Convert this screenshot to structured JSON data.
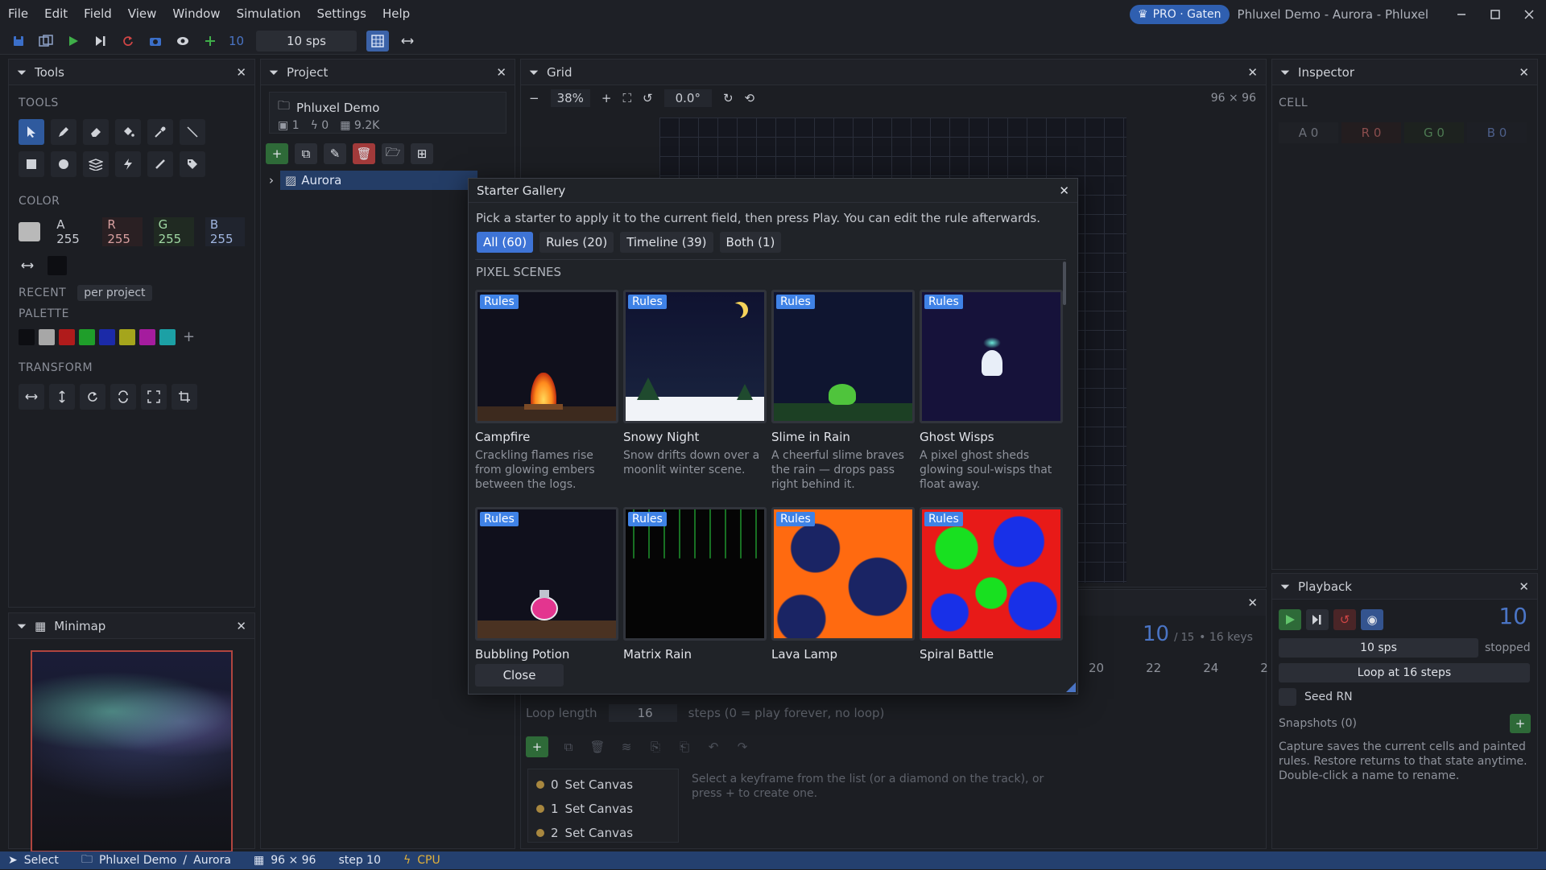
{
  "menu": [
    "File",
    "Edit",
    "Field",
    "View",
    "Window",
    "Simulation",
    "Settings",
    "Help"
  ],
  "window": {
    "badge": "PRO · Gaten",
    "title": "Phluxel Demo - Aurora - Phluxel"
  },
  "toolbar": {
    "step_count": "10",
    "sps": "10 sps"
  },
  "tools_panel": {
    "title": "Tools",
    "tools_label": "TOOLS",
    "color_label": "COLOR",
    "a": "A 255",
    "r": "R 255",
    "g": "G 255",
    "b": "B 255",
    "recent_label": "RECENT",
    "recent_mode": "per project",
    "palette_label": "PALETTE",
    "transform_label": "TRANSFORM",
    "palette": [
      "#0d0e12",
      "#a7a7a7",
      "#b01b1b",
      "#1f9e2a",
      "#1b2aa8",
      "#a5a51c",
      "#a51c9e",
      "#1ca0a5"
    ]
  },
  "minimap": {
    "title": "Minimap"
  },
  "project": {
    "title": "Project",
    "name": "Phluxel Demo",
    "images": "1",
    "rules": "0",
    "size": "9.2K",
    "item": "Aurora"
  },
  "grid_panel": {
    "title": "Grid",
    "zoom": "38%",
    "angle": "0.0°",
    "dims": "96 × 96"
  },
  "inspector": {
    "title": "Inspector",
    "cell_label": "CELL",
    "a": "A 0",
    "r": "R 0",
    "g": "G 0",
    "b": "B 0"
  },
  "playback": {
    "title": "Playback",
    "step": "10",
    "state": "stopped",
    "sps": "10 sps",
    "loop": "Loop at 16 steps",
    "seed": "Seed RN",
    "snapshots": "Snapshots (0)",
    "help": "Capture saves the current cells and painted rules. Restore returns to that state anytime. Double-click a name to rename."
  },
  "timeline": {
    "step": "10",
    "of": "/ 15",
    "keys": "• 16 keys",
    "ticks": [
      "20",
      "22",
      "24",
      "2"
    ],
    "loop_label": "Loop length",
    "loop_value": "16",
    "loop_hint": "steps (0 = play forever, no loop)",
    "hint": "Select a keyframe from the list (or a diamond on the track), or press + to create one.",
    "keyframes": [
      {
        "i": "0",
        "label": "Set Canvas"
      },
      {
        "i": "1",
        "label": "Set Canvas"
      },
      {
        "i": "2",
        "label": "Set Canvas"
      }
    ]
  },
  "gallery": {
    "title": "Starter Gallery",
    "subtitle": "Pick a starter to apply it to the current field, then press Play. You can edit the rule afterwards.",
    "tabs": [
      "All (60)",
      "Rules (20)",
      "Timeline (39)",
      "Both (1)"
    ],
    "section": "PIXEL SCENES",
    "close_label": "Close",
    "cards": [
      {
        "tag": "Rules",
        "title": "Campfire",
        "desc": "Crackling flames rise from glowing embers between the logs."
      },
      {
        "tag": "Rules",
        "title": "Snowy Night",
        "desc": "Snow drifts down over a moonlit winter scene."
      },
      {
        "tag": "Rules",
        "title": "Slime in Rain",
        "desc": "A cheerful slime braves the rain — drops pass right behind it."
      },
      {
        "tag": "Rules",
        "title": "Ghost Wisps",
        "desc": "A pixel ghost sheds glowing soul-wisps that float away."
      },
      {
        "tag": "Rules",
        "title": "Bubbling Potion",
        "desc": ""
      },
      {
        "tag": "Rules",
        "title": "Matrix Rain",
        "desc": ""
      },
      {
        "tag": "Rules",
        "title": "Lava Lamp",
        "desc": ""
      },
      {
        "tag": "Rules",
        "title": "Spiral Battle",
        "desc": ""
      }
    ]
  },
  "status": {
    "tool": "Select",
    "project": "Phluxel Demo",
    "sep": "/",
    "field": "Aurora",
    "dims": "96 × 96",
    "step": "step 10",
    "device": "CPU"
  }
}
